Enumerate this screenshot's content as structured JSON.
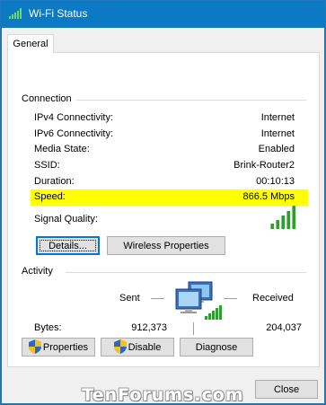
{
  "window": {
    "title": "Wi-Fi Status"
  },
  "tabs": [
    {
      "label": "General",
      "selected": true
    }
  ],
  "connection": {
    "group_title": "Connection",
    "rows": [
      {
        "label": "IPv4 Connectivity:",
        "value": "Internet"
      },
      {
        "label": "IPv6 Connectivity:",
        "value": "Internet"
      },
      {
        "label": "Media State:",
        "value": "Enabled"
      },
      {
        "label": "SSID:",
        "value": "Brink-Router2"
      },
      {
        "label": "Duration:",
        "value": "00:10:13"
      },
      {
        "label": "Speed:",
        "value": "866.5 Mbps",
        "highlighted": true,
        "highlight_color": "#ffff00"
      }
    ],
    "signal_quality_label": "Signal Quality:",
    "signal_bars_level": 5,
    "signal_bars_max": 5,
    "signal_color": "#2e9f2e",
    "details_button": "Details...",
    "wireless_properties_button": "Wireless Properties"
  },
  "activity": {
    "group_title": "Activity",
    "sent_label": "Sent",
    "received_label": "Received",
    "bytes_label": "Bytes:",
    "bytes_sent": "912,373",
    "bytes_received": "204,037",
    "network_icon": "network-computers-icon"
  },
  "actions": {
    "properties_button": "Properties",
    "disable_button": "Disable",
    "diagnose_button": "Diagnose",
    "shield_icon": "uac-shield-icon"
  },
  "footer": {
    "watermark": "TenForums.com",
    "close_button": "Close"
  },
  "colors": {
    "titlebar": "#0b79c4",
    "accent_focus": "#0078d7"
  }
}
